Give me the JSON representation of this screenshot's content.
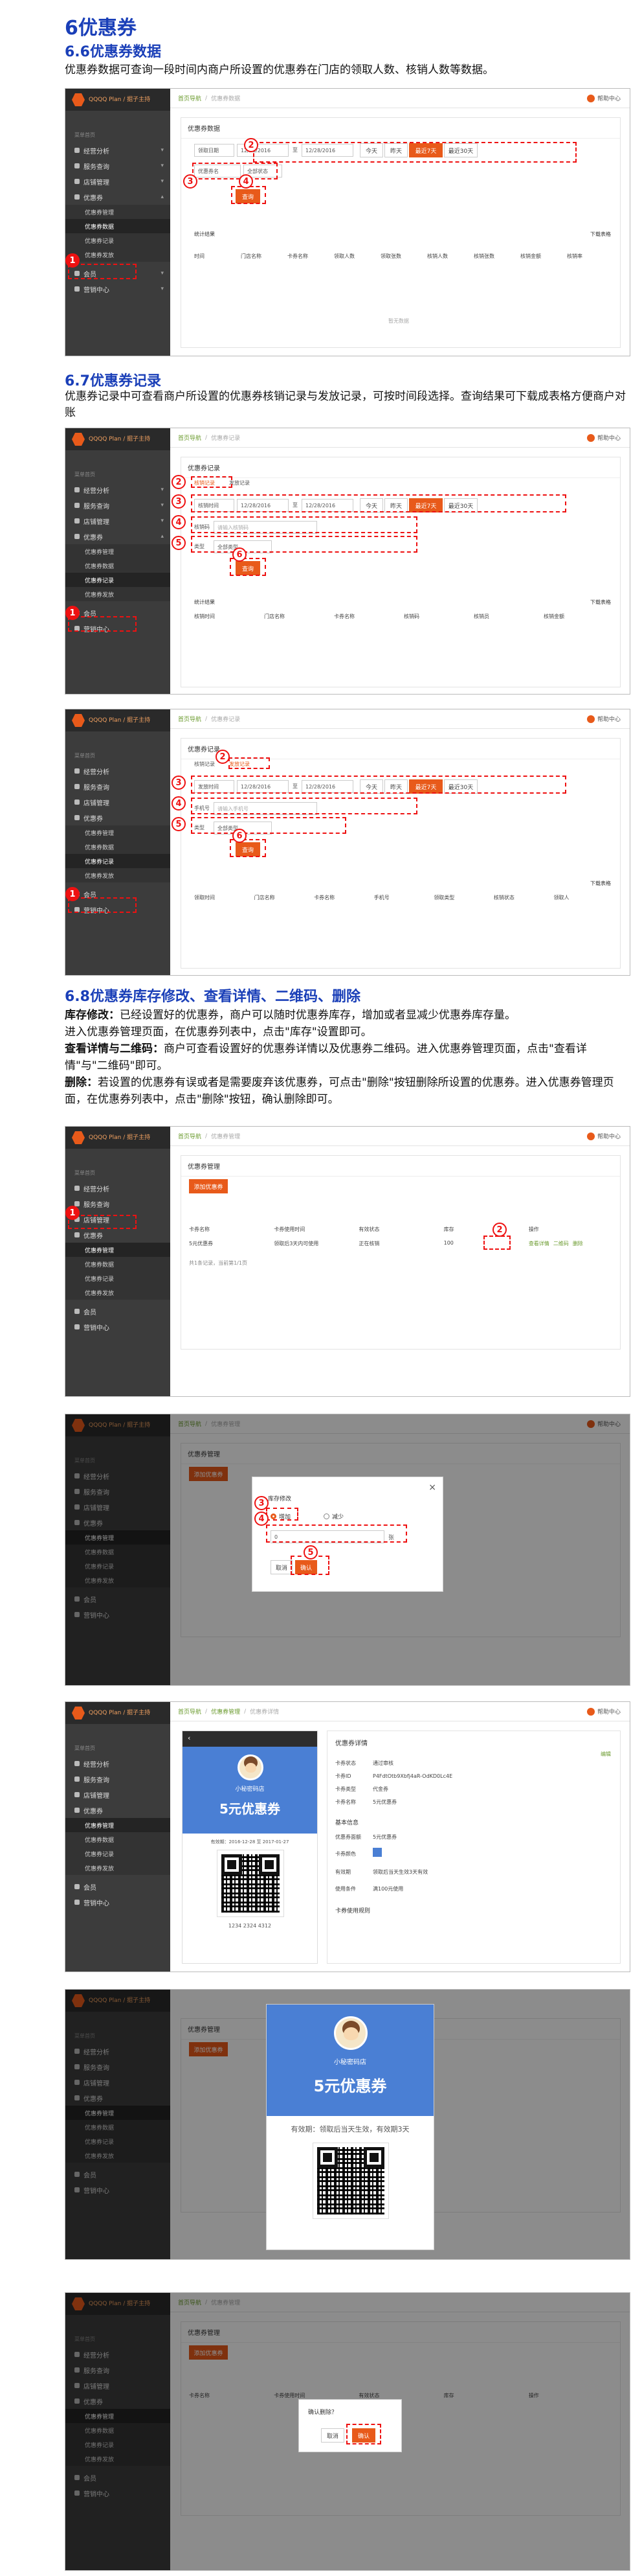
{
  "headings": {
    "main": "6优惠券",
    "s66": "6.6优惠券数据",
    "s67": "6.7优惠券记录",
    "s68": "6.8优惠券库存修改、查看详情、二维码、删除"
  },
  "paragraphs": {
    "p66": "优惠券数据可查询一段时间内商户所设置的优惠券在门店的领取人数、核销人数等数据。",
    "p67": "优惠券记录中可查看商户所设置的优惠券核销记录与发放记录，可按时间段选择。查询结果可下载成表格方便商户对账",
    "p68_1_label": "库存修改：",
    "p68_1": "已经设置好的优惠券，商户可以随时优惠券库存，增加或者显减少优惠券库存量。",
    "p68_2": "进入优惠券管理页面，在优惠券列表中，点击\"库存\"设置即可。",
    "p68_3_label": "查看详情与二维码：",
    "p68_3": "商户可查看设置好的优惠券详情以及优惠券二维码。进入优惠券管理页面，点击\"查看详情\"与\"二维码\"即可。",
    "p68_4_label": "删除：",
    "p68_4": "若设置的优惠券有误或者是需要废弃该优惠券，可点击\"删除\"按钮删除所设置的优惠券。进入优惠券管理页面，在优惠券列表中，点击\"删除\"按钮，确认删除即可。"
  },
  "sidebar": {
    "brand": "QQQQ Plan / 掘子主持",
    "section": "菜单首页",
    "items": [
      "经营分析",
      "服务查询",
      "店铺管理",
      "优惠券"
    ],
    "sub_data": [
      "优惠券管理",
      "优惠券数据",
      "优惠券记录",
      "优惠券发放"
    ],
    "sub_mgmt": [
      "优惠券管理",
      "优惠券数据",
      "优惠券记录",
      "优惠券发放"
    ],
    "bottom": [
      "会员",
      "营销中心"
    ]
  },
  "topbar": {
    "home": "首页导航",
    "sep": "/",
    "data": "优惠券数据",
    "record": "优惠券记录",
    "mgmt": "优惠券管理",
    "detail": "优惠券详情",
    "help": "帮助中心"
  },
  "shot1": {
    "panel_title": "优惠券数据",
    "date_type": "领取日期",
    "date_from": "12/28/2016",
    "to": "至",
    "date_to": "12/28/2016",
    "quick": [
      "今天",
      "昨天",
      "最近7天",
      "最近30天"
    ],
    "coupon_sel": "优惠券名",
    "status_sel": "全部状态",
    "search": "查询",
    "export": "下载表格",
    "summary": "统计结果",
    "cols": [
      "时间",
      "门店名称",
      "卡券名称",
      "领取人数",
      "领取张数",
      "核销人数",
      "核销张数",
      "核销金额",
      "核销率"
    ],
    "empty": "暂无数据"
  },
  "shot2": {
    "panel_title": "优惠券记录",
    "tabs": [
      "核销记录",
      "发放记录"
    ],
    "date_type": "核销时间",
    "date_from": "12/28/2016",
    "to": "至",
    "date_to": "12/28/2016",
    "quick": [
      "今天",
      "昨天",
      "最近7天",
      "最近30天"
    ],
    "code_label": "核销码",
    "code_ph": "请输入核销码",
    "type_label": "类型",
    "type_val": "全部类型",
    "search": "查询",
    "export": "下载表格",
    "summary": "统计结果",
    "cols": [
      "核销时间",
      "门店名称",
      "卡券名称",
      "核销码",
      "核销员",
      "核销金额"
    ]
  },
  "shot3": {
    "panel_title": "优惠券记录",
    "tabs": [
      "核销记录",
      "发放记录"
    ],
    "date_type": "发放时间",
    "date_from": "12/28/2016",
    "to": "至",
    "date_to": "12/28/2016",
    "quick": [
      "今天",
      "昨天",
      "最近7天",
      "最近30天"
    ],
    "phone_label": "手机号",
    "phone_ph": "请输入手机号",
    "type_label": "类型",
    "type_val": "全部类型",
    "search": "查询",
    "export": "下载表格",
    "cols": [
      "领取时间",
      "门店名称",
      "卡券名称",
      "手机号",
      "领取类型",
      "核销状态",
      "领取人"
    ]
  },
  "mgmt": {
    "panel_title": "优惠券管理",
    "add": "添加优惠券",
    "cols": [
      "卡券名称",
      "卡券使用时间",
      "有效状态",
      "库存",
      "操作"
    ],
    "row_name": "5元优惠券",
    "row_time": "领取后3天内可使用",
    "row_status": "正在核销",
    "row_stock": "100",
    "row_ops": [
      "查看详情",
      "二维码",
      "删除"
    ],
    "footer": "共1条记录，当前第1/1页"
  },
  "stock_modal": {
    "title": "库存修改",
    "inc": "增加",
    "dec": "减少",
    "qty": "0",
    "unit": "张",
    "cancel": "取消",
    "confirm": "确认"
  },
  "detail": {
    "shop": "小秘密码店",
    "coupon": "5元优惠券",
    "valid": "有效期：2016-12-28 至 2017-01-27",
    "code": "1234 2324 4312",
    "right_title": "优惠券详情",
    "edit": "编辑",
    "kv": [
      [
        "卡券状态",
        "通过审核"
      ],
      [
        "卡券ID",
        "P4FdtOtb9Xbfj4aR-OdKD0Lc4E"
      ],
      [
        "卡券类型",
        "代金券"
      ],
      [
        "卡券名称",
        "5元优惠券"
      ]
    ],
    "basic": "基本信息",
    "amount_label": "优惠券面额",
    "amount": "5元优惠券",
    "color_label": "卡券颜色",
    "time_label": "有效期",
    "time": "领取后当天生效3天有效",
    "limit_label": "使用条件",
    "limit": "满100元使用",
    "more": "卡券使用规则"
  },
  "qr_modal": {
    "shop": "小秘密码店",
    "coupon": "5元优惠券",
    "valid": "有效期：领取后当天生效，有效期3天"
  },
  "del_modal": {
    "title": "确认删除？",
    "cancel": "取消",
    "confirm": "确认"
  },
  "colors": {
    "accent": "#e85a1a",
    "heading": "#1a3fb8",
    "marker": "#ee1111",
    "coupon_blue": "#4a7fd4"
  }
}
